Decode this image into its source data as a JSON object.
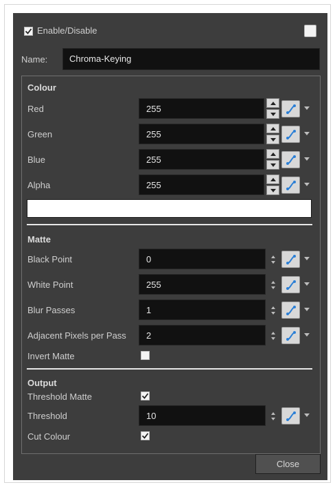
{
  "header": {
    "enable_label": "Enable/Disable",
    "enable_checked": true
  },
  "name": {
    "label": "Name:",
    "value": "Chroma-Keying"
  },
  "colour": {
    "title": "Colour",
    "rows": [
      {
        "label": "Red",
        "value": "255"
      },
      {
        "label": "Green",
        "value": "255"
      },
      {
        "label": "Blue",
        "value": "255"
      },
      {
        "label": "Alpha",
        "value": "255"
      }
    ],
    "swatch_color": "#ffffff"
  },
  "matte": {
    "title": "Matte",
    "rows": [
      {
        "label": "Black Point",
        "value": "0"
      },
      {
        "label": "White Point",
        "value": "255"
      },
      {
        "label": "Blur Passes",
        "value": "1"
      },
      {
        "label": "Adjacent Pixels per Pass",
        "value": "2"
      }
    ],
    "invert_label": "Invert Matte",
    "invert_checked": false
  },
  "output": {
    "title": "Output",
    "threshold_matte_label": "Threshold Matte",
    "threshold_matte_checked": true,
    "threshold_label": "Threshold",
    "threshold_value": "10",
    "cut_colour_label": "Cut Colour",
    "cut_colour_checked": true
  },
  "footer": {
    "close_label": "Close"
  },
  "colors": {
    "dialog_bg": "#3d3d3d",
    "field_bg": "#111111",
    "function_icon": "#2b7fd6"
  }
}
